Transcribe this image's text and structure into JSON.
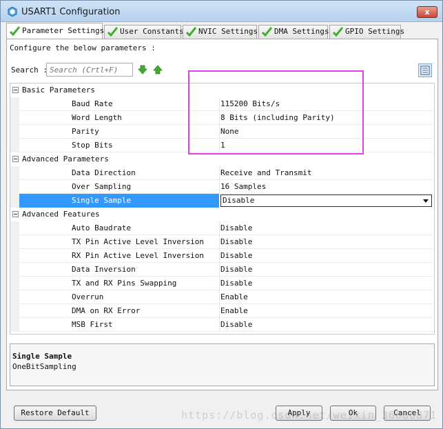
{
  "window": {
    "title": "USART1 Configuration",
    "close_label": "x"
  },
  "tabs": [
    {
      "label": "Parameter Settings",
      "active": true
    },
    {
      "label": "User Constants",
      "active": false
    },
    {
      "label": "NVIC Settings",
      "active": false
    },
    {
      "label": "DMA Settings",
      "active": false
    },
    {
      "label": "GPIO Settings",
      "active": false
    }
  ],
  "panel": {
    "instruction": "Configure the below parameters :",
    "search_label": "Search :",
    "search_placeholder": "Search (Crtl+F)"
  },
  "groups": [
    {
      "label": "Basic Parameters",
      "params": [
        {
          "name": "Baud Rate",
          "value": "115200 Bits/s"
        },
        {
          "name": "Word Length",
          "value": "8 Bits (including Parity)"
        },
        {
          "name": "Parity",
          "value": "None"
        },
        {
          "name": "Stop Bits",
          "value": "1"
        }
      ]
    },
    {
      "label": "Advanced Parameters",
      "params": [
        {
          "name": "Data Direction",
          "value": "Receive and Transmit"
        },
        {
          "name": "Over Sampling",
          "value": "16 Samples"
        },
        {
          "name": "Single Sample",
          "value": "Disable"
        }
      ]
    },
    {
      "label": "Advanced Features",
      "params": [
        {
          "name": "Auto Baudrate",
          "value": "Disable"
        },
        {
          "name": "TX Pin Active Level Inversion",
          "value": "Disable"
        },
        {
          "name": "RX Pin Active Level Inversion",
          "value": "Disable"
        },
        {
          "name": "Data Inversion",
          "value": "Disable"
        },
        {
          "name": "TX and RX Pins Swapping",
          "value": "Disable"
        },
        {
          "name": "Overrun",
          "value": "Enable"
        },
        {
          "name": "DMA on RX Error",
          "value": "Enable"
        },
        {
          "name": "MSB First",
          "value": "Disable"
        }
      ]
    }
  ],
  "description": {
    "title": "Single Sample",
    "text": "OneBitSampling"
  },
  "buttons": {
    "restore": "Restore Default",
    "apply": "Apply",
    "ok": "Ok",
    "cancel": "Cancel"
  },
  "watermark": "https://blog.csdn.net/weixin_36086871",
  "colors": {
    "selection": "#3399ff",
    "annotation": "#e63ee6",
    "tab_check": "#3fae2a",
    "arrow": "#3fae2a"
  }
}
